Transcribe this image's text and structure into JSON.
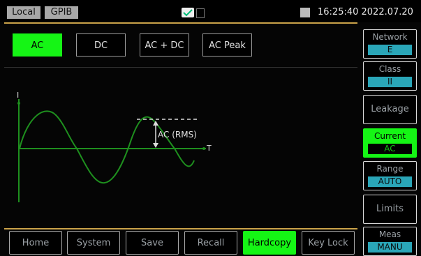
{
  "status": {
    "local": "Local",
    "gpib": "GPIB",
    "datetime": "16:25:40 2022.07.20",
    "icons": [
      "check-icon",
      "battery-icon",
      "lock-icon"
    ]
  },
  "modes": [
    {
      "label": "AC",
      "active": true
    },
    {
      "label": "DC",
      "active": false
    },
    {
      "label": "AC + DC",
      "active": false
    },
    {
      "label": "AC Peak",
      "active": false
    }
  ],
  "graph": {
    "y_axis": "I",
    "x_axis": "T",
    "annotation": "AC (RMS)"
  },
  "side": [
    {
      "title": "Network",
      "value": "E"
    },
    {
      "title": "Class",
      "value": "II"
    },
    {
      "title": "Leakage",
      "value": ""
    },
    {
      "title": "Current",
      "value": "AC"
    },
    {
      "title": "Range",
      "value": "AUTO"
    },
    {
      "title": "Limits",
      "value": ""
    },
    {
      "title": "Meas",
      "value": "MANU"
    }
  ],
  "bottom": [
    {
      "label": "Home"
    },
    {
      "label": "System"
    },
    {
      "label": "Save"
    },
    {
      "label": "Recall"
    },
    {
      "label": "Hardcopy",
      "active": true
    },
    {
      "label": "Key Lock"
    }
  ],
  "colors": {
    "accent_green": "#15f515",
    "value_cyan": "#2aa6b8",
    "frame_gold": "#caa24a",
    "wave_green": "#1e8f1e"
  }
}
